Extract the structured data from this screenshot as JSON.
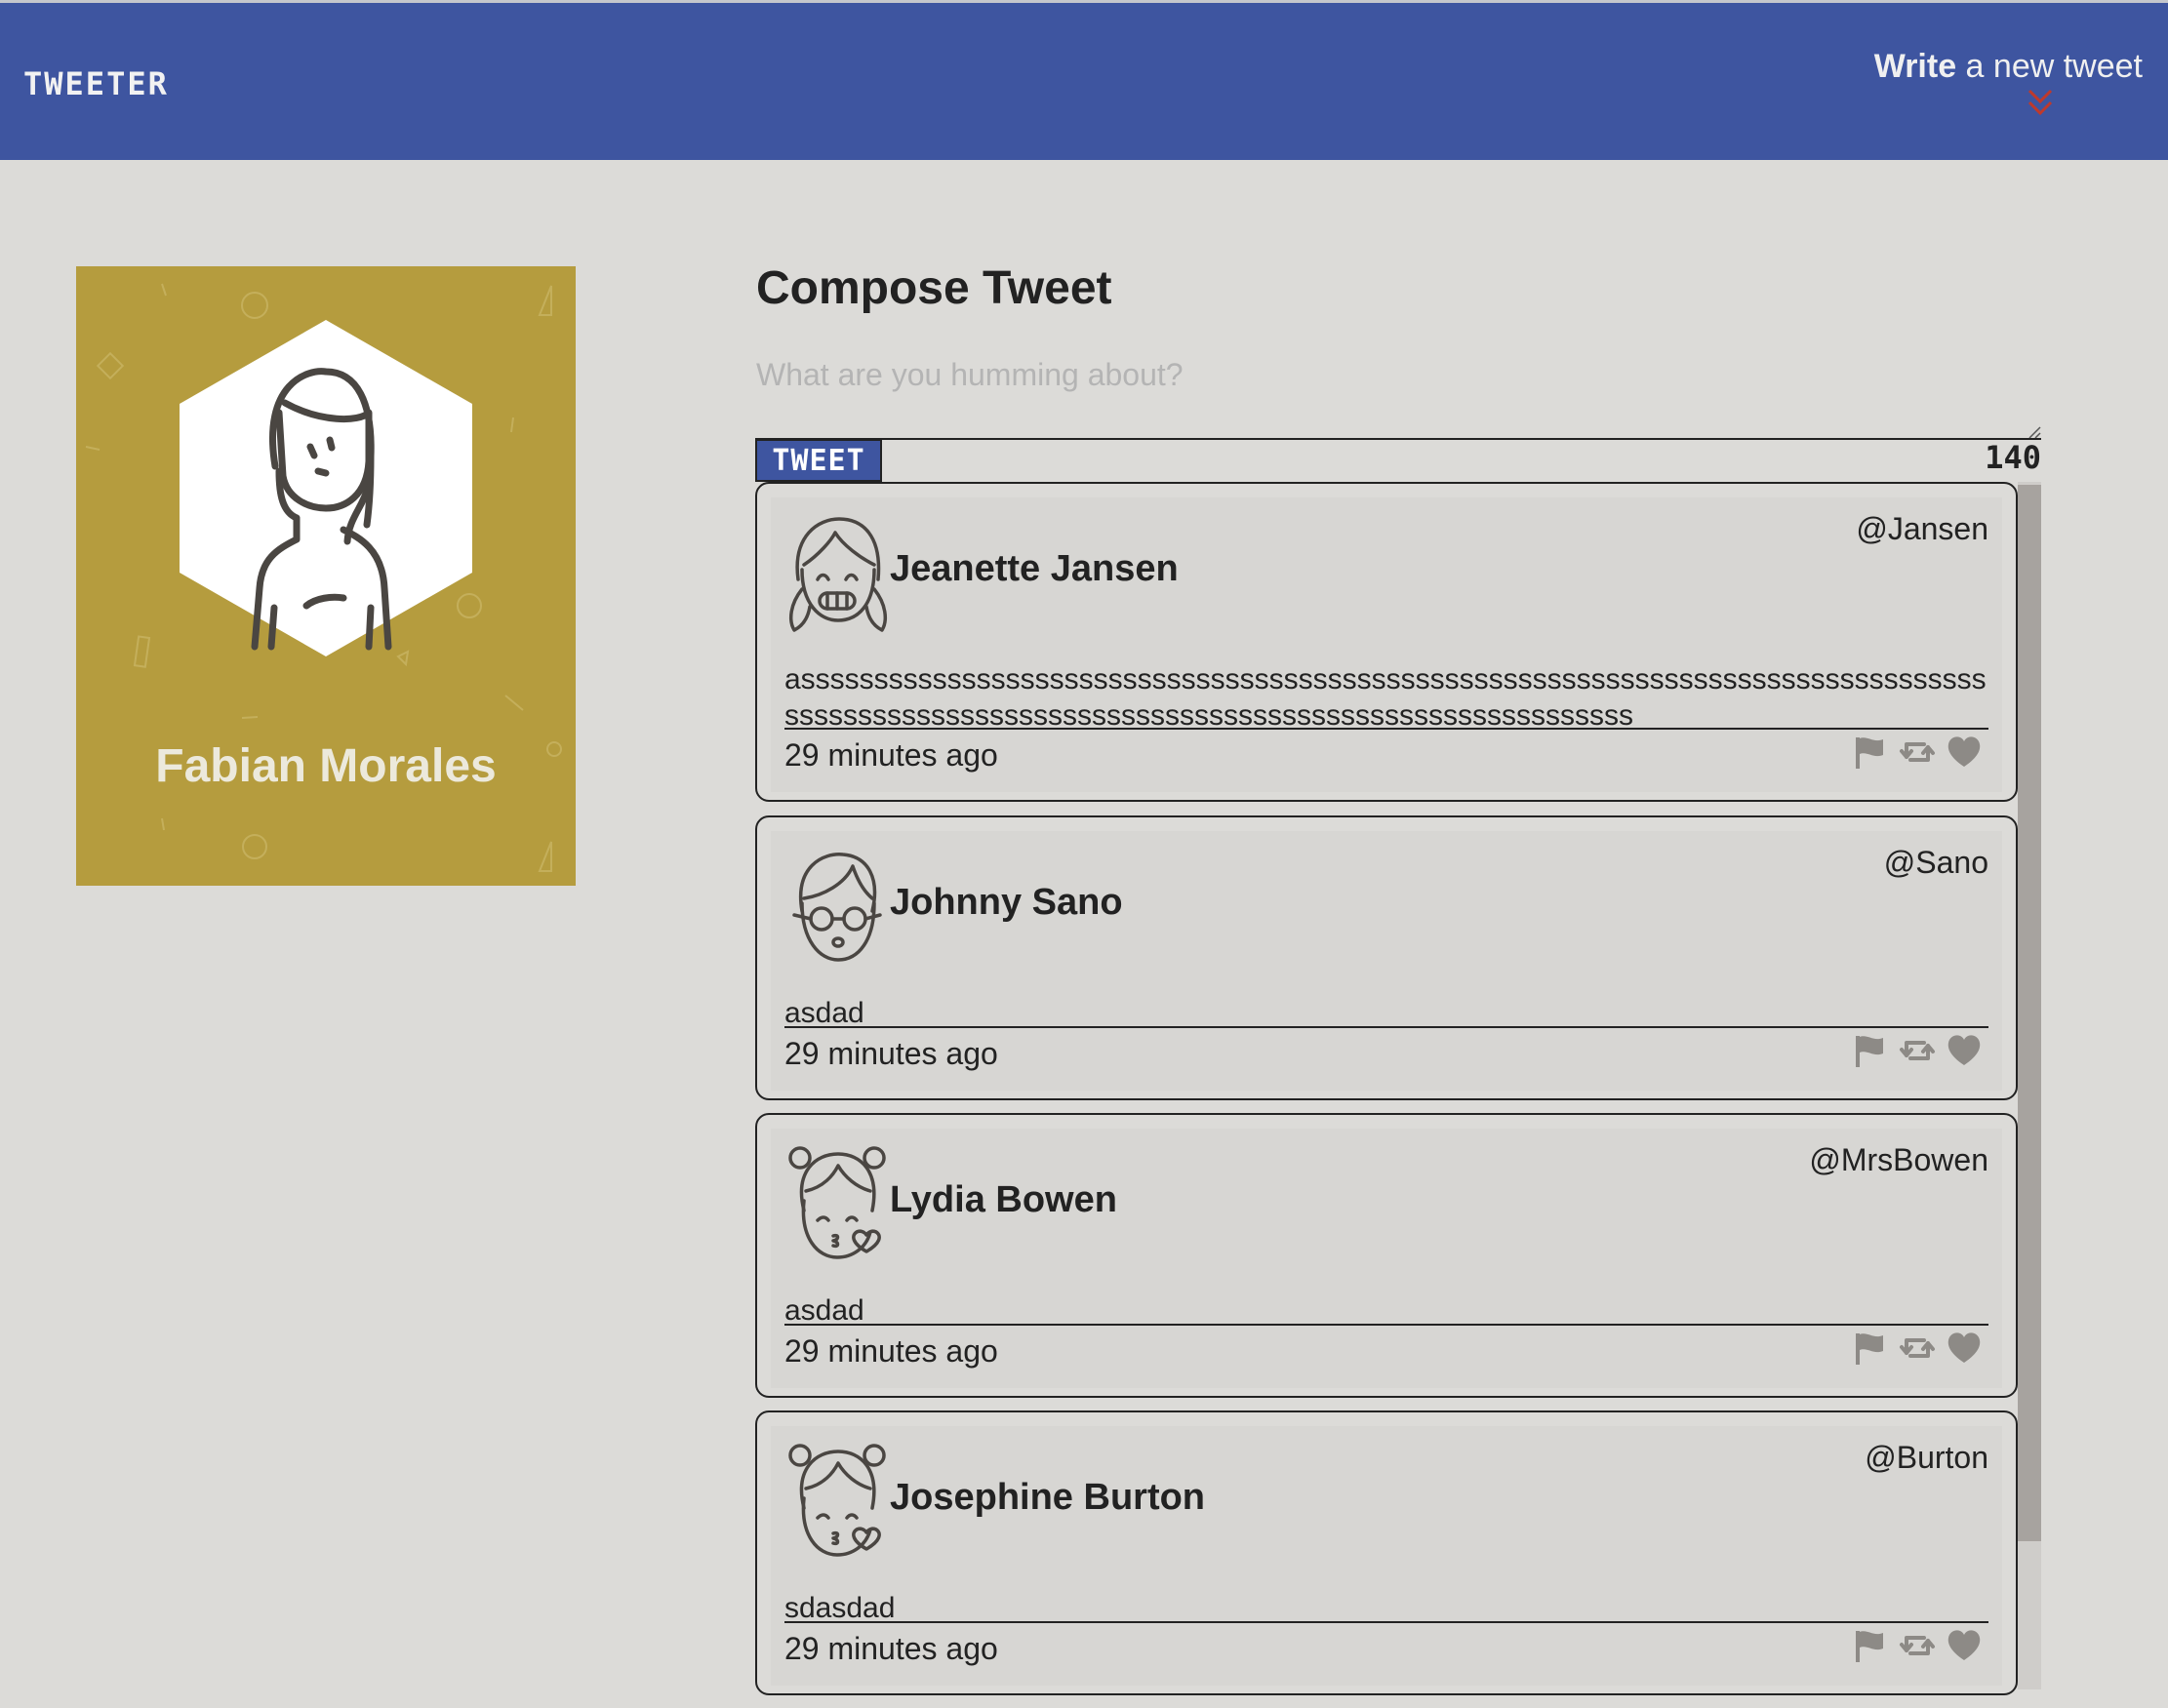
{
  "header": {
    "brand": "TWEETER",
    "write_bold": "Write",
    "write_rest": " a new tweet",
    "chevron_icon": "double-chevron-down-icon",
    "chevron_color": "#c0392b",
    "bg_color": "#3e55a0"
  },
  "profile": {
    "name": "Fabian Morales",
    "avatar_icon": "woman-avatar-icon",
    "card_color": "#b59c3e"
  },
  "compose": {
    "title": "Compose Tweet",
    "placeholder": "What are you humming about?",
    "button_label": "TWEET",
    "counter": "140"
  },
  "tweets": [
    {
      "name": "Jeanette Jansen",
      "handle": "@Jansen",
      "text": "asssssssssssssssssssssssssssssssssssssssssssssssssssssssssssssssssssssssssssssssssssssssssssssssssssssssssssssssssssssssssssssssssssssssssss",
      "time": "29 minutes ago",
      "avatar_icon": "girl-smiling-avatar-icon"
    },
    {
      "name": "Johnny Sano",
      "handle": "@Sano",
      "text": "asdad",
      "time": "29 minutes ago",
      "avatar_icon": "boy-glasses-avatar-icon"
    },
    {
      "name": "Lydia Bowen",
      "handle": "@MrsBowen",
      "text": "asdad",
      "time": "29 minutes ago",
      "avatar_icon": "girl-kiss-avatar-icon"
    },
    {
      "name": "Josephine Burton",
      "handle": "@Burton",
      "text": "sdasdad",
      "time": "29 minutes ago",
      "avatar_icon": "girl-kiss-avatar-icon"
    }
  ],
  "tweet_actions": [
    "flag-icon",
    "retweet-icon",
    "heart-icon"
  ],
  "colors": {
    "page_bg": "#dcdbd8",
    "action_icon": "#8d8a86",
    "scroll_thumb": "#a7a39f"
  }
}
